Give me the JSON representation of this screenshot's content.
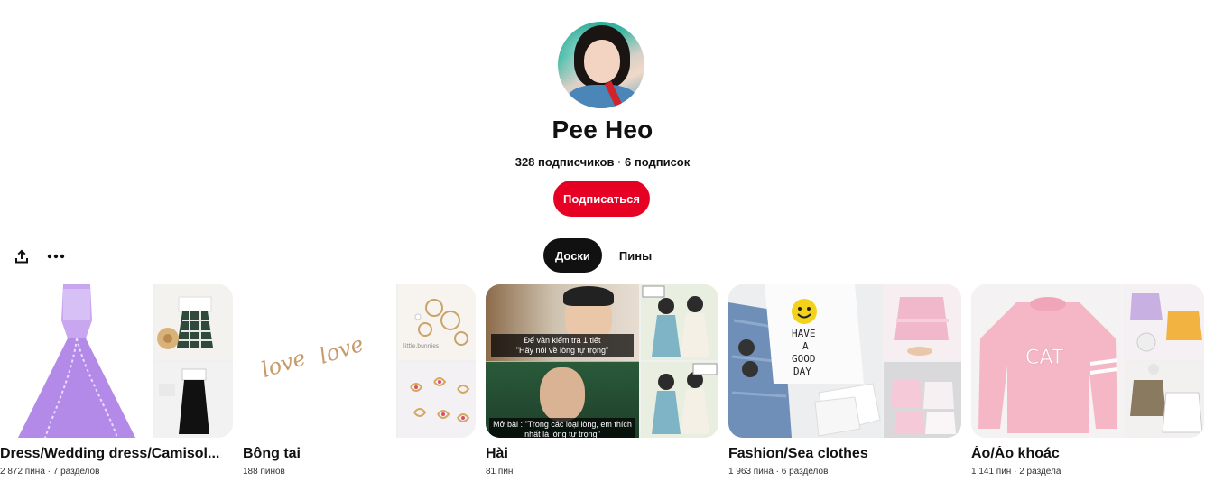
{
  "profile": {
    "name": "Pee Heo",
    "followers": "328 подписчиков",
    "separator": " · ",
    "following": "6 подписок",
    "follow_label": "Подписаться"
  },
  "toolbar": {
    "share_icon": "share-icon",
    "more_icon": "more-dots-icon"
  },
  "tabs": [
    {
      "label": "Доски",
      "active": true
    },
    {
      "label": "Пины",
      "active": false
    }
  ],
  "boards": [
    {
      "title": "Dress/Wedding dress/Camisol...",
      "meta": "2 872 пина · 7 разделов"
    },
    {
      "title": "Bông tai",
      "meta": "188 пинов"
    },
    {
      "title": "Hài",
      "meta": "81 пин"
    },
    {
      "title": "Fashion/Sea clothes",
      "meta": "1 963 пина · 6 разделов"
    },
    {
      "title": "Áo/Áo khoác",
      "meta": "1 141 пин · 2 раздела"
    }
  ],
  "cover_text": {
    "love_left": "love",
    "love_right": "love",
    "earring_brand": "little.bunnies",
    "meme_caption_1": "Để vần kiểm tra 1 tiết\n\"Hãy nói về lòng tự trọng\"",
    "meme_caption_2": "Mở bài : \"Trong các loại lòng, em thích nhất là lòng tự trọng\"",
    "tee_line1": "HAVE",
    "tee_line2": "A",
    "tee_line3": "GOOD",
    "tee_line4": "DAY",
    "sweater_text": "CAT"
  },
  "colors": {
    "accent": "#e60023",
    "tab_active_bg": "#111111"
  }
}
